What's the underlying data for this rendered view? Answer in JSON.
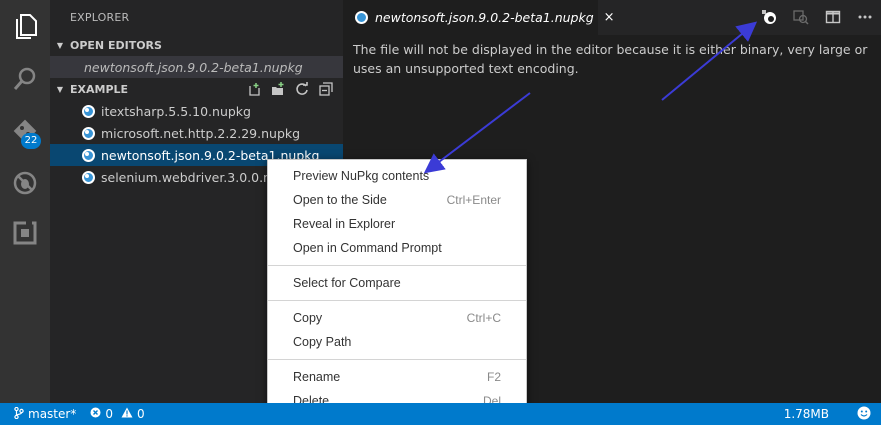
{
  "activity_bar": {
    "items": [
      {
        "icon": "files-icon"
      },
      {
        "icon": "search-icon"
      },
      {
        "icon": "source-control-icon",
        "badge": "22"
      },
      {
        "icon": "debug-icon"
      },
      {
        "icon": "extensions-icon"
      }
    ]
  },
  "sidebar": {
    "title": "EXPLORER",
    "open_editors": {
      "header": "OPEN EDITORS",
      "items": [
        "newtonsoft.json.9.0.2-beta1.nupkg"
      ]
    },
    "folder": {
      "header": "EXAMPLE",
      "actions": [
        "new-file-icon",
        "new-folder-icon",
        "refresh-icon",
        "collapse-all-icon"
      ],
      "files": [
        "itextsharp.5.5.10.nupkg",
        "microsoft.net.http.2.2.29.nupkg",
        "newtonsoft.json.9.0.2-beta1.nupkg",
        "selenium.webdriver.3.0.0.nupkg"
      ]
    }
  },
  "editor": {
    "tab": {
      "label": "newtonsoft.json.9.0.2-beta1.nupkg",
      "close": "×"
    },
    "actions": [
      "preview-nupkg-icon",
      "open-changes-icon",
      "split-editor-icon",
      "more-actions-icon"
    ],
    "message": "The file will not be displayed in the editor because it is either binary, very large or uses an unsupported text encoding."
  },
  "context_menu": {
    "groups": [
      [
        {
          "label": "Preview NuPkg contents",
          "shortcut": ""
        },
        {
          "label": "Open to the Side",
          "shortcut": "Ctrl+Enter"
        },
        {
          "label": "Reveal in Explorer",
          "shortcut": ""
        },
        {
          "label": "Open in Command Prompt",
          "shortcut": ""
        }
      ],
      [
        {
          "label": "Select for Compare",
          "shortcut": ""
        }
      ],
      [
        {
          "label": "Copy",
          "shortcut": "Ctrl+C"
        },
        {
          "label": "Copy Path",
          "shortcut": ""
        }
      ],
      [
        {
          "label": "Rename",
          "shortcut": "F2"
        },
        {
          "label": "Delete",
          "shortcut": "Del"
        }
      ]
    ]
  },
  "status_bar": {
    "branch": "master*",
    "errors": "0",
    "warnings": "0",
    "file_size": "1.78MB"
  },
  "colors": {
    "accent": "#007acc",
    "selection": "#094771",
    "annotation_arrow": "#3b3bd6"
  }
}
